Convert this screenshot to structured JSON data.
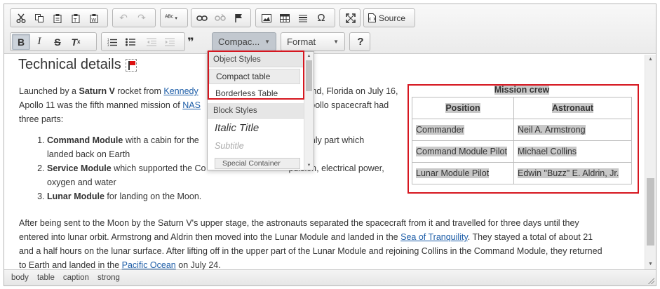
{
  "toolbar": {
    "source_label": "Source",
    "styles_combo": "Compac...",
    "format_combo": "Format",
    "help_label": "?"
  },
  "content": {
    "heading": "Technical details",
    "intro": {
      "p1": "Launched by a ",
      "saturn": "Saturn V",
      "p2": " rocket from ",
      "kennedy": "Kennedy",
      "p3": "land, Florida on July 16,",
      "line2_a": "Apollo 11 was the fifth manned mission of ",
      "nasa": "NAS",
      "line2_b": "Apollo spacecraft had",
      "line3": "three parts:"
    },
    "parts": [
      {
        "name": "Command Module",
        "text_a": " with a cabin for the ",
        "text_b": "s the only part which",
        "text_c": "landed back on Earth"
      },
      {
        "name": "Service Module",
        "text_a": " which supported the Co",
        "text_b": "pulsion, electrical power,",
        "text_c": "oxygen and water"
      },
      {
        "name": "Lunar Module",
        "text_a": " for landing on the Moon."
      }
    ],
    "para2": {
      "line1": "After being sent to the Moon by the Saturn V's upper stage, the astronauts separated the spacecraft from it and travelled for three days until they",
      "line2_a": "entered into lunar orbit. Armstrong and Aldrin then moved into the Lunar Module and landed in the ",
      "sea": "Sea of Tranquility",
      "line2_b": ". They stayed a total of about 21",
      "line3": "and a half hours on the lunar surface. After lifting off in the upper part of the Lunar Module and rejoining Collins in the Command Module, they returned",
      "line4_a": "to Earth and landed in the ",
      "pacific": "Pacific Ocean",
      "line4_b": " on July 24."
    },
    "crew_table": {
      "caption": "Mission crew",
      "headers": [
        "Position",
        "Astronaut"
      ],
      "rows": [
        [
          "Commander",
          "Neil A. Armstrong"
        ],
        [
          "Command Module Pilot",
          "Michael Collins"
        ],
        [
          "Lunar Module Pilot",
          "Edwin \"Buzz\" E. Aldrin, Jr."
        ]
      ]
    }
  },
  "dropdown": {
    "object_heading": "Object Styles",
    "object_items": [
      "Compact table",
      "Borderless Table"
    ],
    "block_heading": "Block Styles",
    "italic_title": "Italic Title",
    "subtitle": "Subtitle",
    "special": "Special Container"
  },
  "statusbar": {
    "path": [
      "body",
      "table",
      "caption",
      "strong"
    ]
  },
  "colors": {
    "highlight_outline": "#d6161f",
    "link": "#1e5ea8"
  }
}
